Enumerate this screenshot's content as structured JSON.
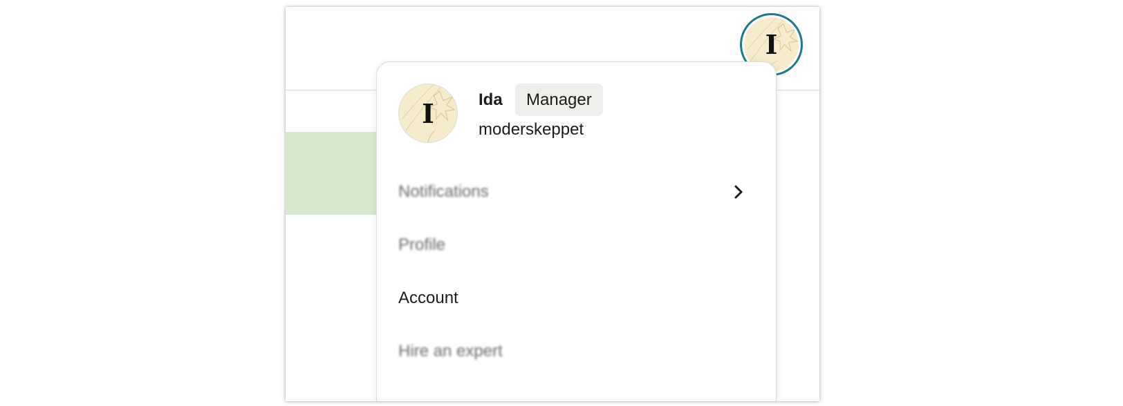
{
  "user": {
    "initial": "I",
    "name": "Ida",
    "role_badge": "Manager",
    "shop_name": "moderskeppet"
  },
  "menu": {
    "items": [
      {
        "label": "Notifications",
        "has_submenu": true,
        "icon": "chevron-right-icon"
      },
      {
        "label": "Profile"
      },
      {
        "label": "Account"
      },
      {
        "label": "Hire an expert"
      }
    ]
  },
  "colors": {
    "avatar_ring": "#1a7b86",
    "avatar_bg": "#f6eccb",
    "badge_bg": "#efeeeb",
    "green_block": "#d7e9cc",
    "text": "#1d1b19"
  },
  "icons": {
    "avatar_decoration": "starburst-sketch-icon",
    "submenu": "chevron-right-icon"
  }
}
